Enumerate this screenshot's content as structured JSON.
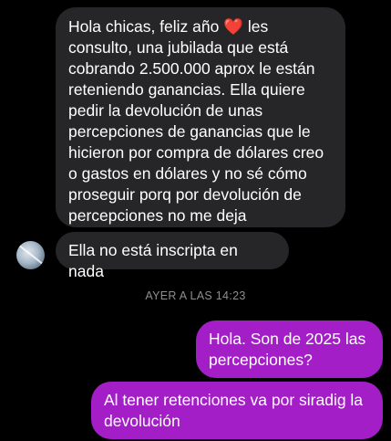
{
  "messages": [
    {
      "direction": "incoming",
      "text_part1": "Hola chicas, feliz año ",
      "emoji": "red-heart",
      "text_part2": " les\nconsulto, una jubilada que está\ncobrando 2.500.000 aprox le están\nreteniendo ganancias. Ella quiere\npedir la devolución de unas\npercepciones de ganancias que le\nhicieron por compra de dólares creo\no gastos en dólares y no sé cómo\nproseguir porq por devolución de\npercepciones no me deja"
    },
    {
      "direction": "incoming",
      "text": "Ella no está inscripta en nada"
    },
    {
      "direction": "outgoing",
      "text": "Hola. Son de 2025 las\npercepciones?"
    },
    {
      "direction": "outgoing",
      "text": "Al tener retenciones va por siradig la\ndevolución"
    }
  ],
  "timestamp": "AYER A LAS 14:23",
  "colors": {
    "incoming_bubble": "#262628",
    "outgoing_bubble": "#a41ec7",
    "timestamp_text": "#8e8e93"
  }
}
